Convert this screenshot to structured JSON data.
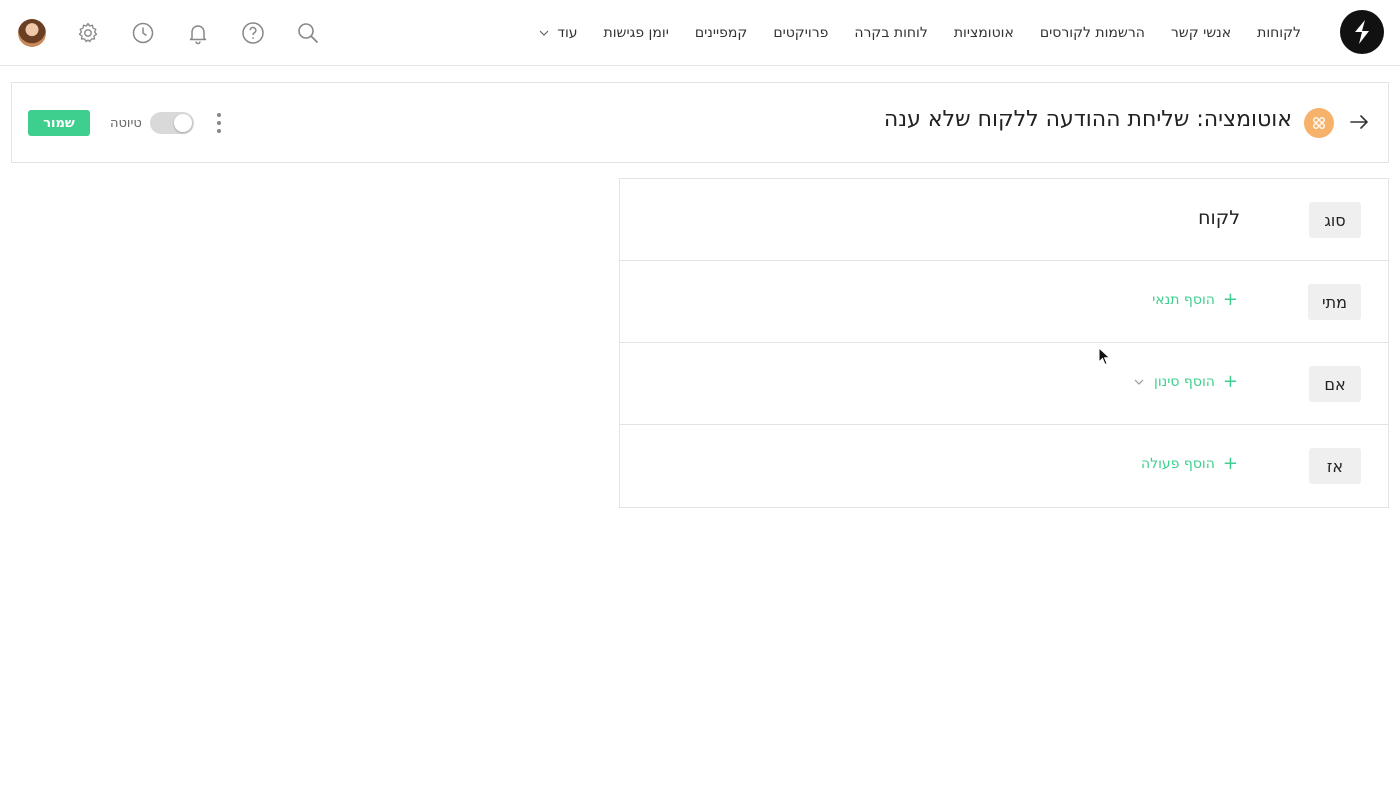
{
  "nav": {
    "links": [
      "לקוחות",
      "אנשי קשר",
      "הרשמות לקורסים",
      "אוטומציות",
      "לוחות בקרה",
      "פרויקטים",
      "קמפיינים",
      "יומן פגישות"
    ],
    "more_label": "עוד",
    "icons": [
      "search-icon",
      "help-icon",
      "bell-icon",
      "clock-icon",
      "gear-icon",
      "avatar"
    ]
  },
  "header": {
    "title": "אוטומציה: שליחת ההודעה ללקוח שלא ענה",
    "draft_label": "טיוטה",
    "save_label": "שמור",
    "draft_toggle_on": false
  },
  "rules": [
    {
      "tag": "סוג",
      "value": "לקוח"
    },
    {
      "tag": "מתי",
      "add": "הוסף תנאי"
    },
    {
      "tag": "אם",
      "add": "הוסף סינון"
    },
    {
      "tag": "אז",
      "add": "הוסף פעולה"
    }
  ],
  "colors": {
    "accent": "#3ecf8e",
    "automation_icon": "#f6b26b",
    "logo": "#111111"
  }
}
